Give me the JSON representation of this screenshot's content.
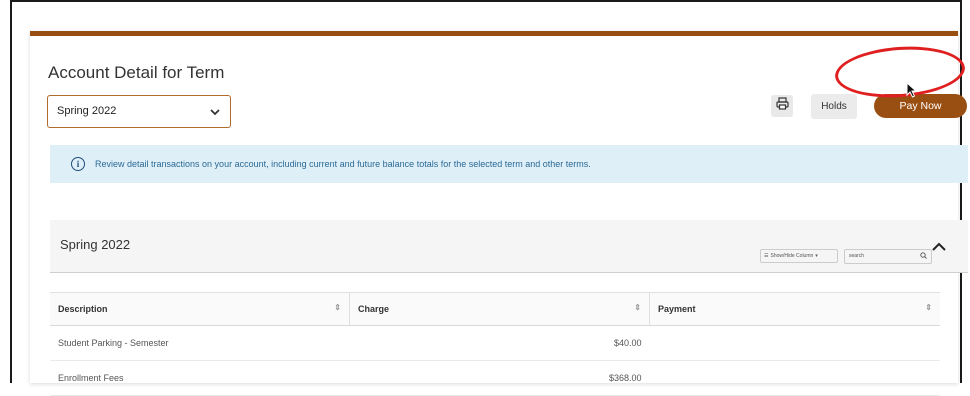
{
  "page": {
    "title": "Account Detail for Term",
    "term_select": {
      "value": "Spring 2022"
    },
    "actions": {
      "holds_label": "Holds",
      "pay_now_label": "Pay Now"
    }
  },
  "info_banner": {
    "text": "Review detail transactions on your account, including current and future balance totals for the selected term and other terms."
  },
  "term_section": {
    "label": "Spring 2022",
    "tools": {
      "show_hide_label": "Show/Hide Column",
      "search_placeholder": "search"
    }
  },
  "table": {
    "columns": [
      "Description",
      "Charge",
      "Payment"
    ],
    "rows": [
      {
        "description": "Student Parking - Semester",
        "charge": "$40.00",
        "payment": ""
      },
      {
        "description": "Enrollment Fees",
        "charge": "$368.00",
        "payment": ""
      }
    ]
  },
  "colors": {
    "brand": "#9a4f12",
    "info_bg": "#dfeff8",
    "annotation": "#e02020"
  }
}
